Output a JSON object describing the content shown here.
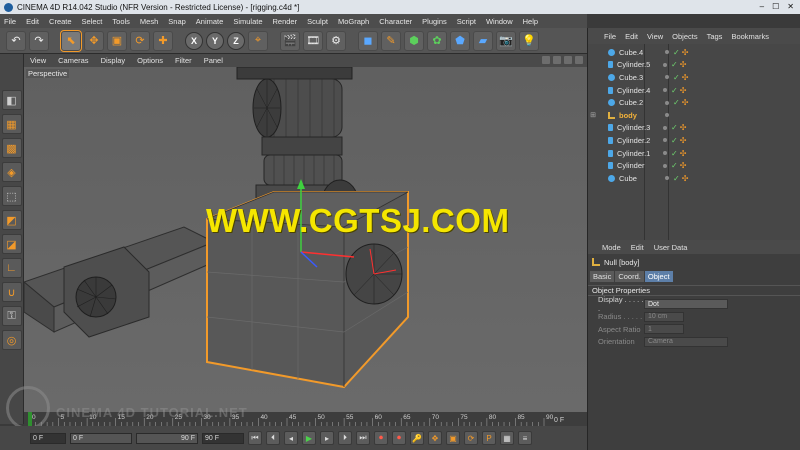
{
  "window": {
    "title": "CINEMA 4D R14.042 Studio (NFR Version - Restricted License) - [rigging.c4d *]"
  },
  "menubar": {
    "items": [
      "File",
      "Edit",
      "Create",
      "Select",
      "Tools",
      "Mesh",
      "Snap",
      "Animate",
      "Simulate",
      "Render",
      "Sculpt",
      "MoGraph",
      "Character",
      "Plugins",
      "Script",
      "Window",
      "Help"
    ]
  },
  "toolbar": {
    "axis_x": "X",
    "axis_y": "Y",
    "axis_z": "Z"
  },
  "viewport": {
    "menu": [
      "View",
      "Cameras",
      "Display",
      "Options",
      "Filter",
      "Panel"
    ],
    "label": "Perspective",
    "watermark": "WWW.CGTSJ.COM"
  },
  "timeline": {
    "ticks": [
      "0",
      "5",
      "10",
      "15",
      "20",
      "25",
      "30",
      "35",
      "40",
      "45",
      "50",
      "55",
      "60",
      "65",
      "70",
      "75",
      "80",
      "85",
      "90"
    ],
    "current_frame_label": "0 F"
  },
  "transport": {
    "start_frame": "0 F",
    "min_field": "0 F",
    "max_field": "90 F",
    "end_frame": "90 F",
    "watermark_text": "CINEMA 4D TUTORIAL.NET"
  },
  "object_manager": {
    "menu": [
      "File",
      "Edit",
      "View",
      "Objects",
      "Tags",
      "Bookmarks"
    ],
    "objects": [
      {
        "name": "Cube.4",
        "type": "cube",
        "expanded": false,
        "highlight": false
      },
      {
        "name": "Cylinder.5",
        "type": "cylinder",
        "expanded": false,
        "highlight": false
      },
      {
        "name": "Cube.3",
        "type": "cube",
        "expanded": false,
        "highlight": false
      },
      {
        "name": "Cylinder.4",
        "type": "cylinder",
        "expanded": false,
        "highlight": false
      },
      {
        "name": "Cube.2",
        "type": "cube",
        "expanded": false,
        "highlight": false
      },
      {
        "name": "body",
        "type": "null",
        "expanded": true,
        "highlight": true
      },
      {
        "name": "Cylinder.3",
        "type": "cylinder",
        "expanded": false,
        "highlight": false
      },
      {
        "name": "Cylinder.2",
        "type": "cylinder",
        "expanded": false,
        "highlight": false
      },
      {
        "name": "Cylinder.1",
        "type": "cylinder",
        "expanded": false,
        "highlight": false
      },
      {
        "name": "Cylinder",
        "type": "cylinder",
        "expanded": false,
        "highlight": false
      },
      {
        "name": "Cube",
        "type": "cube",
        "expanded": false,
        "highlight": false
      }
    ]
  },
  "attribute_manager": {
    "menu": [
      "Mode",
      "Edit",
      "User Data"
    ],
    "object_title": "Null [body]",
    "tabs": [
      "Basic",
      "Coord.",
      "Object"
    ],
    "active_tab": "Object",
    "section": "Object Properties",
    "fields": [
      {
        "label": "Display . . . . . .",
        "value": "Dot",
        "enabled": true
      },
      {
        "label": "Radius . . . . .",
        "value": "10 cm",
        "enabled": false
      },
      {
        "label": "Aspect Ratio",
        "value": "1",
        "enabled": false
      },
      {
        "label": "Orientation",
        "value": "Camera",
        "enabled": false
      }
    ]
  },
  "colors": {
    "accent": "#f29a2a",
    "selection": "#f3b23a",
    "watermark": "#f5e600"
  }
}
